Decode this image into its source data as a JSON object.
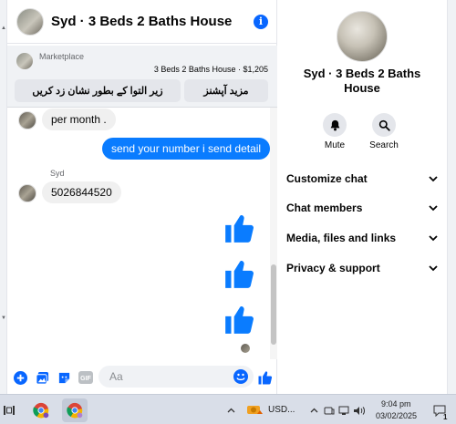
{
  "chat": {
    "header_title": "Syd · 3 Beds 2 Baths House",
    "marketplace_label": "Marketplace",
    "listing": "3 Beds 2 Baths House · $1,205",
    "buttons": [
      "زیر التوا کے بطور نشان زد کریں",
      "مزید آپشنز"
    ],
    "messages": [
      {
        "from": "them",
        "text": "per month ."
      },
      {
        "from": "me",
        "text": "send your number i send detail"
      },
      {
        "from": "them",
        "sender": "Syd",
        "text": "5026844520"
      },
      {
        "from": "me",
        "type": "like"
      },
      {
        "from": "me",
        "type": "like"
      },
      {
        "from": "me",
        "type": "like"
      }
    ],
    "composer_placeholder": "Aa"
  },
  "details": {
    "title": "Syd · 3 Beds 2 Baths House",
    "actions": [
      {
        "label": "Mute",
        "icon": "bell-icon"
      },
      {
        "label": "Search",
        "icon": "search-icon"
      }
    ],
    "sections": [
      "Customize chat",
      "Chat members",
      "Media, files and links",
      "Privacy & support"
    ]
  },
  "taskbar": {
    "currency_ticker": "USD...",
    "time": "9:04 pm",
    "date": "03/02/2025",
    "notification_count": "1"
  },
  "colors": {
    "accent": "#0866ff",
    "outgoing_bubble": "#0a7cff",
    "incoming_bubble": "#f0f0f0"
  }
}
